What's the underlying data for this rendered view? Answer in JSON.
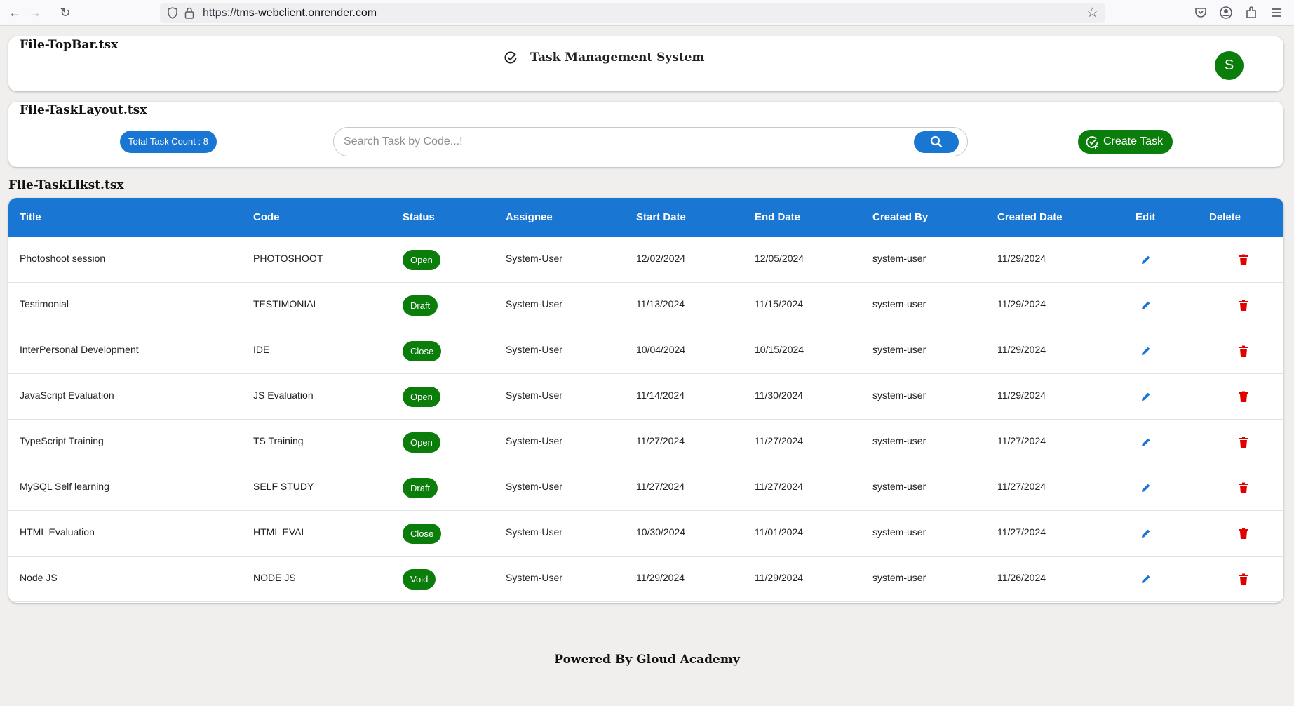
{
  "browser": {
    "url_prefix": "https://",
    "url_host": "tms-webclient.onrender.com"
  },
  "topbar": {
    "file_label": "File-TopBar.tsx",
    "app_title": "Task Management System",
    "avatar_letter": "S"
  },
  "task_layout": {
    "file_label": "File-TaskLayout.tsx",
    "task_count": "Total Task Count : 8",
    "search_placeholder": "Search Task by Code...!",
    "create_label": "Create Task"
  },
  "task_list": {
    "file_label": "File-TaskLikst.tsx",
    "columns": [
      "Title",
      "Code",
      "Status",
      "Assignee",
      "Start Date",
      "End Date",
      "Created By",
      "Created Date",
      "Edit",
      "Delete"
    ],
    "rows": [
      {
        "title": "Photoshoot session",
        "code": "PHOTOSHOOT",
        "status": "Open",
        "assignee": "System-User",
        "start": "12/02/2024",
        "end": "12/05/2024",
        "created_by": "system-user",
        "created": "11/29/2024"
      },
      {
        "title": "Testimonial",
        "code": "TESTIMONIAL",
        "status": "Draft",
        "assignee": "System-User",
        "start": "11/13/2024",
        "end": "11/15/2024",
        "created_by": "system-user",
        "created": "11/29/2024"
      },
      {
        "title": "InterPersonal Development",
        "code": "IDE",
        "status": "Close",
        "assignee": "System-User",
        "start": "10/04/2024",
        "end": "10/15/2024",
        "created_by": "system-user",
        "created": "11/29/2024"
      },
      {
        "title": "JavaScript Evaluation",
        "code": "JS Evaluation",
        "status": "Open",
        "assignee": "System-User",
        "start": "11/14/2024",
        "end": "11/30/2024",
        "created_by": "system-user",
        "created": "11/29/2024"
      },
      {
        "title": "TypeScript Training",
        "code": "TS Training",
        "status": "Open",
        "assignee": "System-User",
        "start": "11/27/2024",
        "end": "11/27/2024",
        "created_by": "system-user",
        "created": "11/27/2024"
      },
      {
        "title": "MySQL Self learning",
        "code": "SELF STUDY",
        "status": "Draft",
        "assignee": "System-User",
        "start": "11/27/2024",
        "end": "11/27/2024",
        "created_by": "system-user",
        "created": "11/27/2024"
      },
      {
        "title": "HTML Evaluation",
        "code": "HTML EVAL",
        "status": "Close",
        "assignee": "System-User",
        "start": "10/30/2024",
        "end": "11/01/2024",
        "created_by": "system-user",
        "created": "11/27/2024"
      },
      {
        "title": "Node JS",
        "code": "NODE JS",
        "status": "Void",
        "assignee": "System-User",
        "start": "11/29/2024",
        "end": "11/29/2024",
        "created_by": "system-user",
        "created": "11/26/2024"
      }
    ]
  },
  "footer": {
    "text": "Powered By Gloud Academy"
  },
  "colors": {
    "primary_blue": "#1976d2",
    "success_green": "#0a7d0a",
    "delete_red": "#e00000",
    "page_bg": "#f0efee"
  },
  "icons": {
    "title_icon": "check-circle-icon",
    "search": "search-icon",
    "create": "add-task-icon",
    "edit": "pencil-icon",
    "delete": "trash-icon"
  }
}
